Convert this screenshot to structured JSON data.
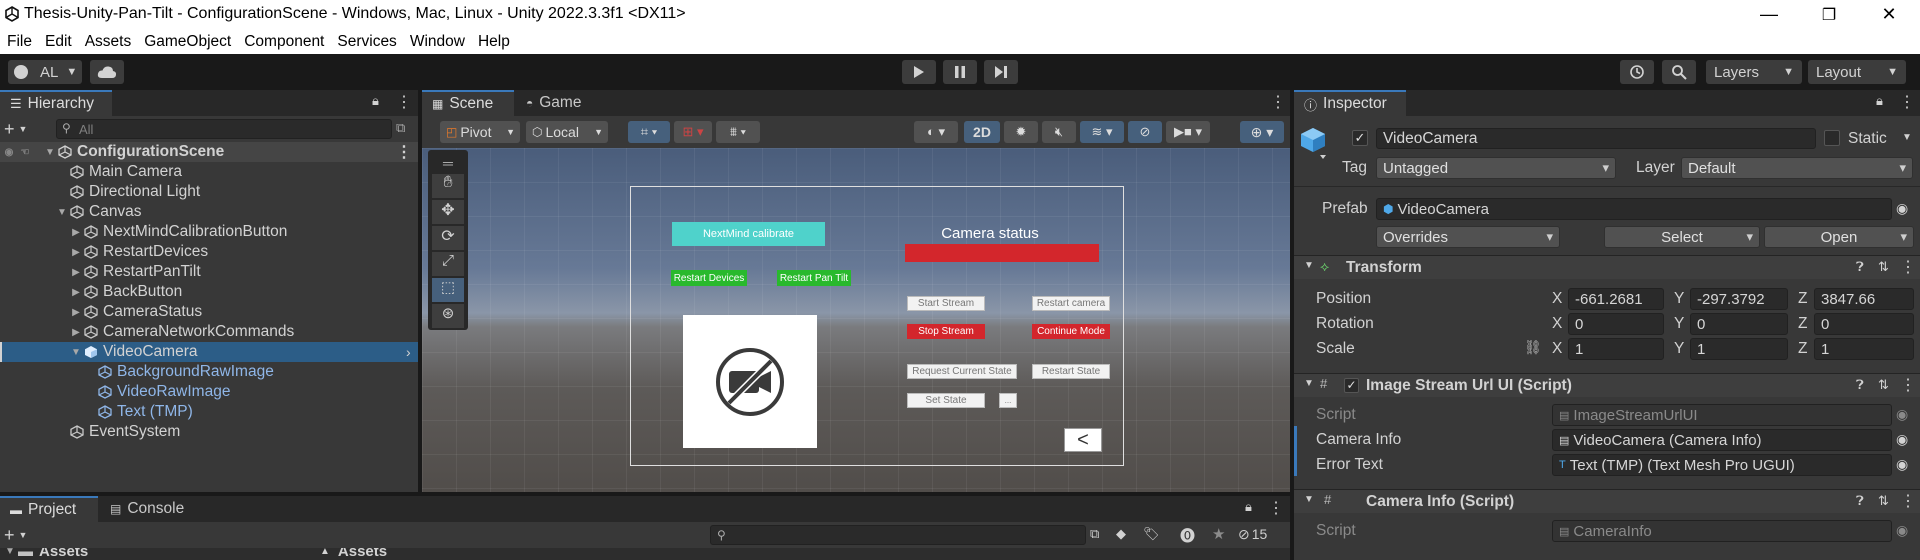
{
  "window": {
    "title": "Thesis-Unity-Pan-Tilt - ConfigurationScene - Windows, Mac, Linux - Unity 2022.3.3f1 <DX11>",
    "minimize": "—",
    "maximize": "❐",
    "close": "✕"
  },
  "menu": [
    "File",
    "Edit",
    "Assets",
    "GameObject",
    "Component",
    "Services",
    "Window",
    "Help"
  ],
  "toolbar": {
    "account": "AL",
    "layers": "Layers",
    "layout": "Layout"
  },
  "hierarchy": {
    "tab": "Hierarchy",
    "search_placeholder": "All",
    "scene": "ConfigurationScene",
    "items": [
      {
        "label": "Main Camera",
        "indent": 1,
        "caret": "",
        "blue": false
      },
      {
        "label": "Directional Light",
        "indent": 1,
        "caret": "",
        "blue": false
      },
      {
        "label": "Canvas",
        "indent": 1,
        "caret": "▼",
        "blue": false
      },
      {
        "label": "NextMindCalibrationButton",
        "indent": 2,
        "caret": "▶",
        "blue": false
      },
      {
        "label": "RestartDevices",
        "indent": 2,
        "caret": "▶",
        "blue": false
      },
      {
        "label": "RestartPanTilt",
        "indent": 2,
        "caret": "▶",
        "blue": false
      },
      {
        "label": "BackButton",
        "indent": 2,
        "caret": "▶",
        "blue": false
      },
      {
        "label": "CameraStatus",
        "indent": 2,
        "caret": "▶",
        "blue": false
      },
      {
        "label": "CameraNetworkCommands",
        "indent": 2,
        "caret": "▶",
        "blue": false
      },
      {
        "label": "VideoCamera",
        "indent": 2,
        "caret": "▼",
        "blue": false,
        "selected": true
      },
      {
        "label": "BackgroundRawImage",
        "indent": 3,
        "caret": "",
        "blue": true
      },
      {
        "label": "VideoRawImage",
        "indent": 3,
        "caret": "",
        "blue": true
      },
      {
        "label": "Text (TMP)",
        "indent": 3,
        "caret": "",
        "blue": true
      },
      {
        "label": "EventSystem",
        "indent": 1,
        "caret": "",
        "blue": false
      }
    ]
  },
  "scene_view": {
    "tabs": [
      "Scene",
      "Game"
    ],
    "pivot": "Pivot",
    "local": "Local",
    "mode_2d": "2D",
    "canvas": {
      "calibrate": "NextMind calibrate",
      "restart_devices": "Restart Devices",
      "restart_pan_tilt": "Restart Pan Tilt",
      "camera_status": "Camera status",
      "start_stream": "Start Stream",
      "restart_camera": "Restart camera",
      "stop_stream": "Stop Stream",
      "continue_mode": "Continue Mode",
      "request_state": "Request Current State",
      "restart_state": "Restart State",
      "set_state": "Set State",
      "small_field": "...",
      "back": "<"
    }
  },
  "project": {
    "tabs": [
      "Project",
      "Console"
    ],
    "assets_left": "Assets",
    "assets_right": "Assets",
    "badge_count": "15"
  },
  "inspector": {
    "tab": "Inspector",
    "object_name": "VideoCamera",
    "static_label": "Static",
    "tag_label": "Tag",
    "tag_value": "Untagged",
    "layer_label": "Layer",
    "layer_value": "Default",
    "prefab_label": "Prefab",
    "prefab_value": "VideoCamera",
    "overrides": "Overrides",
    "select": "Select",
    "open": "Open",
    "transform": {
      "title": "Transform",
      "position_label": "Position",
      "rotation_label": "Rotation",
      "scale_label": "Scale",
      "position": {
        "x": "-661.2681",
        "y": "-297.3792",
        "z": "3847.66"
      },
      "rotation": {
        "x": "0",
        "y": "0",
        "z": "0"
      },
      "scale": {
        "x": "1",
        "y": "1",
        "z": "1"
      }
    },
    "image_stream": {
      "title": "Image Stream Url UI (Script)",
      "script_label": "Script",
      "script_value": "ImageStreamUrlUI",
      "camera_info_label": "Camera Info",
      "camera_info_value": "VideoCamera (Camera Info)",
      "error_text_label": "Error Text",
      "error_text_value": "Text (TMP) (Text Mesh Pro UGUI)"
    },
    "camera_info": {
      "title": "Camera Info (Script)",
      "script_label": "Script",
      "script_value": "CameraInfo"
    }
  },
  "colors": {
    "accent_blue": "#2c5d87",
    "button_teal": "#4fd2cb",
    "button_green": "#29b92d",
    "button_red": "#d3262c",
    "status_red": "#d3262c"
  }
}
